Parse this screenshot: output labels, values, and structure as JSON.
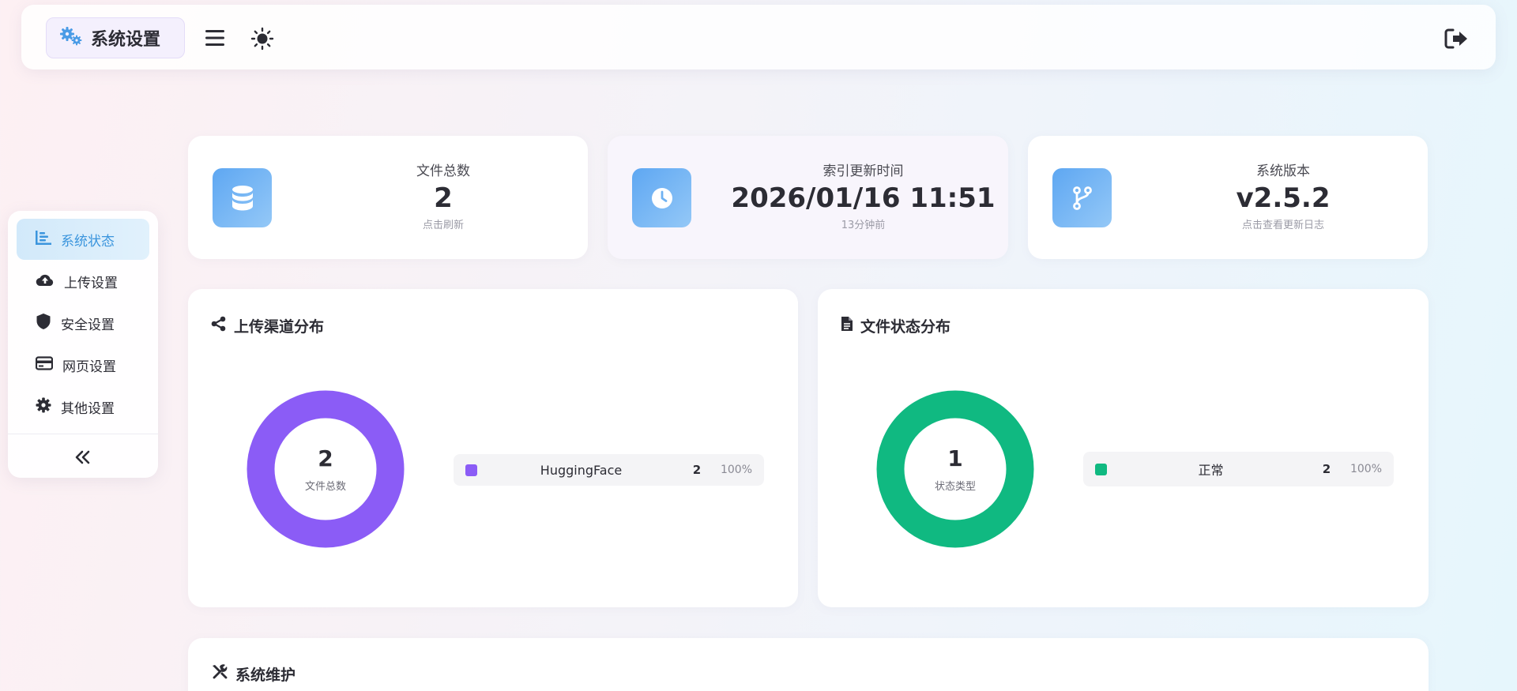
{
  "header": {
    "title": "系统设置",
    "icons": {
      "brand": "gears-icon",
      "menu": "hamburger-menu-icon",
      "theme": "sun-icon",
      "logout": "logout-icon"
    }
  },
  "sidebar": {
    "items": [
      {
        "label": "系统状态",
        "icon": "chart-bar-icon",
        "active": true
      },
      {
        "label": "上传设置",
        "icon": "cloud-upload-icon",
        "active": false
      },
      {
        "label": "安全设置",
        "icon": "shield-icon",
        "active": false
      },
      {
        "label": "网页设置",
        "icon": "credit-card-icon",
        "active": false
      },
      {
        "label": "其他设置",
        "icon": "gear-icon",
        "active": false
      }
    ],
    "collapse_icon": "double-chevron-left-icon"
  },
  "stats": [
    {
      "label": "文件总数",
      "value": "2",
      "sub": "点击刷新",
      "icon": "database-icon"
    },
    {
      "label": "索引更新时间",
      "value": "2026/01/16 11:51",
      "sub": "13分钟前",
      "icon": "clock-icon"
    },
    {
      "label": "系统版本",
      "value": "v2.5.2",
      "sub": "点击查看更新日志",
      "icon": "code-branch-icon"
    }
  ],
  "channel_panel": {
    "title": "上传渠道分布",
    "icon": "share-nodes-icon",
    "center_value": "2",
    "center_label": "文件总数",
    "legend": [
      {
        "name": "HuggingFace",
        "count": "2",
        "percent": "100%",
        "color": "#8b5cf6"
      }
    ]
  },
  "status_panel": {
    "title": "文件状态分布",
    "icon": "file-icon",
    "center_value": "1",
    "center_label": "状态类型",
    "legend": [
      {
        "name": "正常",
        "count": "2",
        "percent": "100%",
        "color": "#10b981"
      }
    ]
  },
  "maintenance_panel": {
    "title": "系统维护",
    "icon": "tools-icon"
  },
  "chart_data": [
    {
      "type": "pie",
      "categories": [
        "HuggingFace"
      ],
      "values": [
        2
      ],
      "title": "上传渠道分布"
    },
    {
      "type": "pie",
      "categories": [
        "正常"
      ],
      "values": [
        2
      ],
      "title": "文件状态分布"
    }
  ],
  "colors": {
    "accent": "#3b95dd",
    "purple": "#8b5cf6",
    "green": "#10b981"
  }
}
